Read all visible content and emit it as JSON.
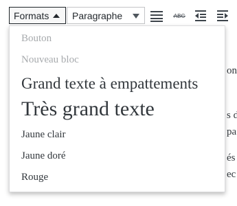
{
  "toolbar": {
    "formats_label": "Formats",
    "paragraph_select": {
      "selected": "Paragraphe"
    },
    "icons": [
      "align-justify-icon",
      "strikethrough-icon",
      "outdent-icon",
      "indent-icon"
    ],
    "strikethrough_text": "ABC"
  },
  "formats_menu": {
    "items": [
      {
        "label": "Bouton",
        "disabled": true
      },
      {
        "label": "Nouveau bloc",
        "disabled": true
      },
      {
        "label": "Grand texte à empattements",
        "disabled": false
      },
      {
        "label": "Très grand texte",
        "disabled": false
      },
      {
        "label": "Jaune clair",
        "disabled": false
      },
      {
        "label": "Jaune doré",
        "disabled": false
      },
      {
        "label": "Rouge",
        "disabled": false
      }
    ]
  },
  "background_fragments": [
    "on",
    "s d",
    "pa",
    "és",
    "ec"
  ],
  "colors": {
    "border_dark": "#1d2327",
    "text": "#32373c",
    "disabled_text": "#a7aaad"
  }
}
